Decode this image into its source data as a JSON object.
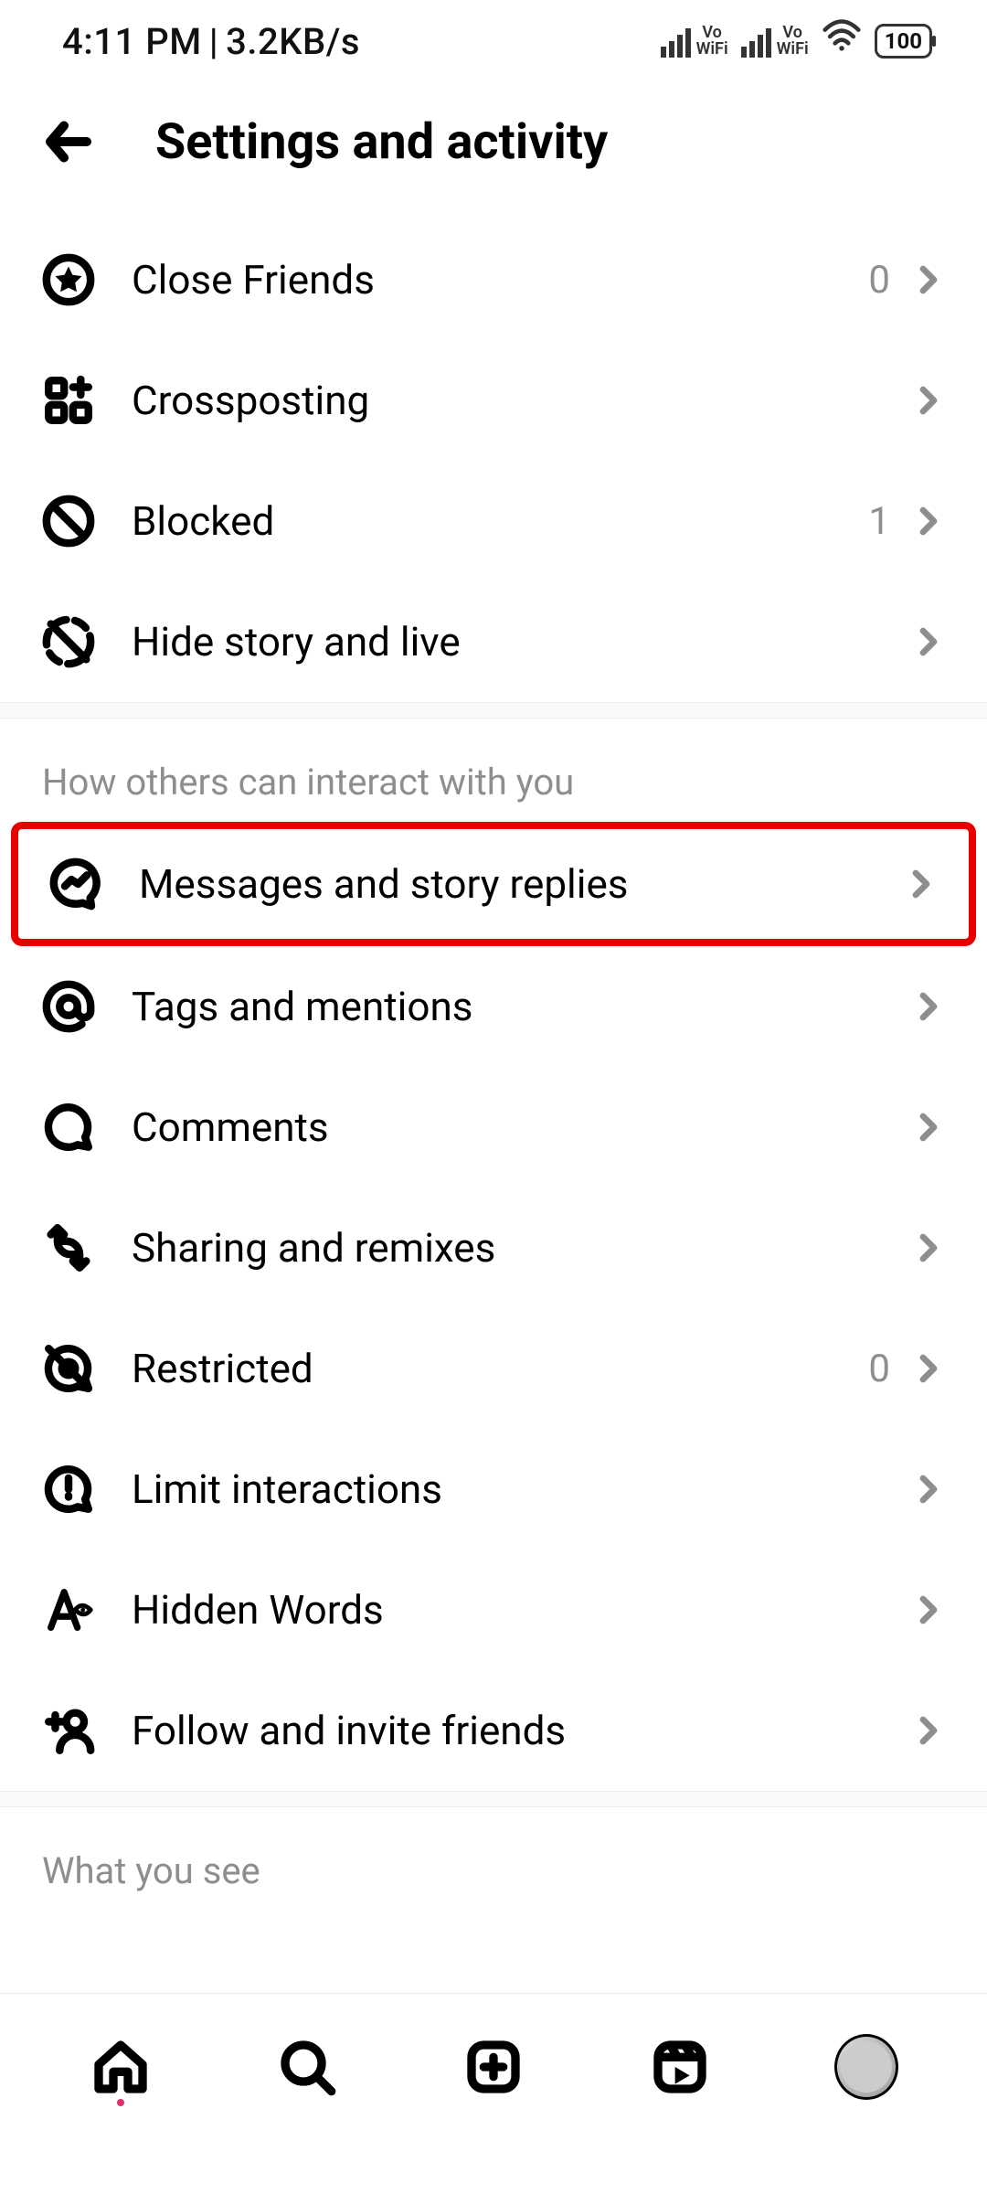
{
  "status": {
    "time": "4:11 PM",
    "speed": "3.2KB/s",
    "vowifi": "Vo\nWiFi",
    "battery": "100"
  },
  "header": {
    "title": "Settings and activity"
  },
  "group1": {
    "items": [
      {
        "label": "Close Friends",
        "value": "0",
        "icon": "star-circle"
      },
      {
        "label": "Crossposting",
        "value": "",
        "icon": "crosspost"
      },
      {
        "label": "Blocked",
        "value": "1",
        "icon": "blocked"
      },
      {
        "label": "Hide story and live",
        "value": "",
        "icon": "hide-story"
      }
    ]
  },
  "section_interact_title": "How others can interact with you",
  "group2": {
    "items": [
      {
        "label": "Messages and story replies",
        "value": "",
        "icon": "messenger",
        "highlight": true
      },
      {
        "label": "Tags and mentions",
        "value": "",
        "icon": "at"
      },
      {
        "label": "Comments",
        "value": "",
        "icon": "comment"
      },
      {
        "label": "Sharing and remixes",
        "value": "",
        "icon": "sharing"
      },
      {
        "label": "Restricted",
        "value": "0",
        "icon": "restricted"
      },
      {
        "label": "Limit interactions",
        "value": "",
        "icon": "limit"
      },
      {
        "label": "Hidden Words",
        "value": "",
        "icon": "hidden-words"
      },
      {
        "label": "Follow and invite friends",
        "value": "",
        "icon": "follow-invite"
      }
    ]
  },
  "section_whatyousee_title": "What you see"
}
